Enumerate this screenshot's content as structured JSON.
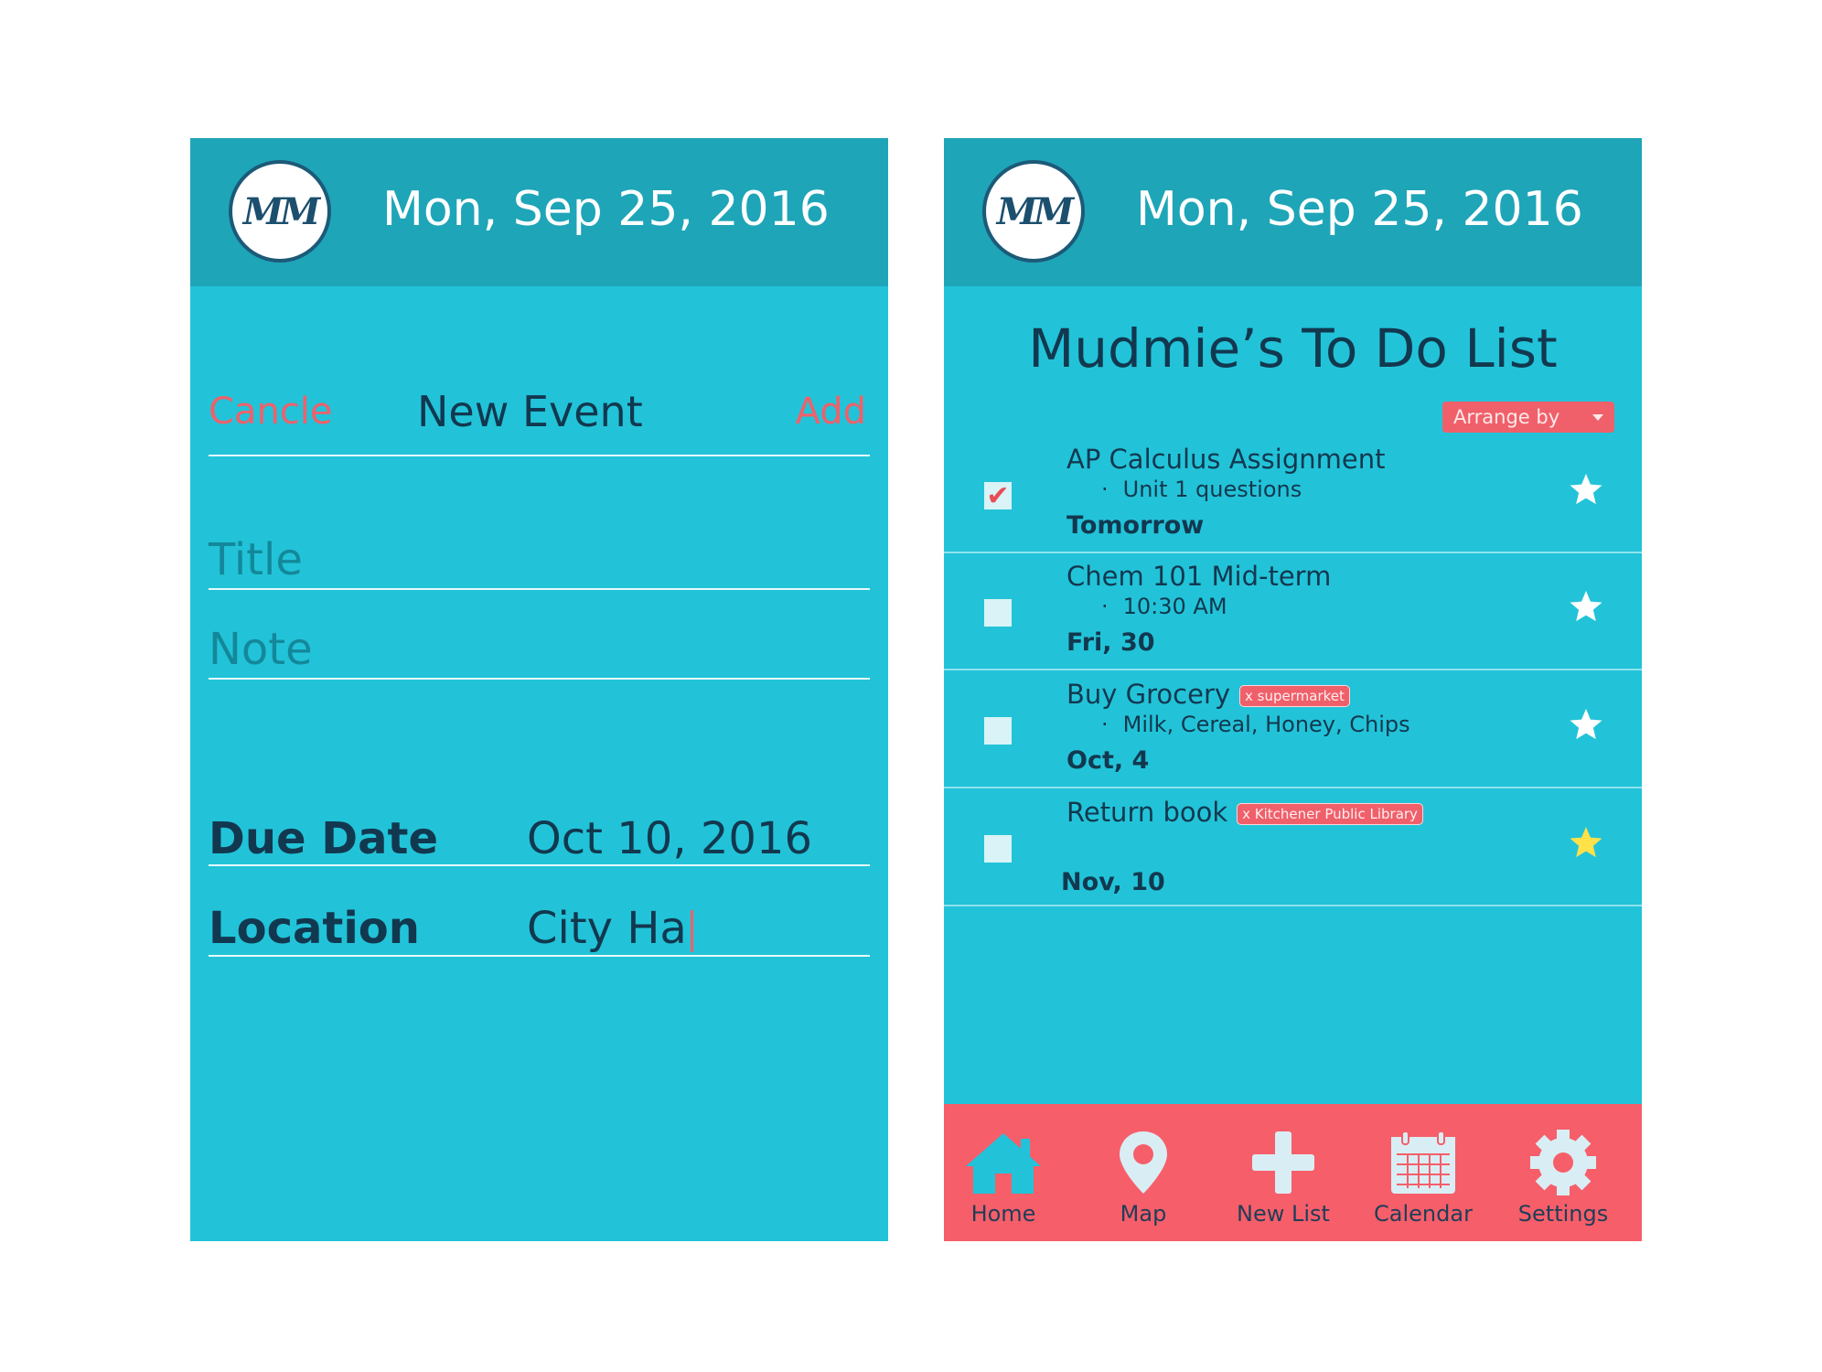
{
  "left_screen": {
    "header": {
      "logo_text": "MM",
      "date": "Mon, Sep 25, 2016"
    },
    "toolbar": {
      "cancel_label": "Cancle",
      "title": "New Event",
      "add_label": "Add"
    },
    "form": {
      "title_placeholder": "Title",
      "note_placeholder": "Note",
      "due_date_label": "Due Date",
      "due_date_value": "Oct 10, 2016",
      "location_label": "Location",
      "location_value": "City Ha"
    }
  },
  "right_screen": {
    "header": {
      "logo_text": "MM",
      "date": "Mon, Sep 25, 2016"
    },
    "list_title": "Mudmie’s To Do List",
    "arrange_label": "Arrange by",
    "items": [
      {
        "title": "AP Calculus Assignment",
        "tag": "",
        "detail": "Unit 1 questions",
        "due": "Tomorrow",
        "checked": true,
        "starred": false
      },
      {
        "title": "Chem 101 Mid-term",
        "tag": "",
        "detail": "10:30 AM",
        "due": "Fri, 30",
        "checked": false,
        "starred": false
      },
      {
        "title": "Buy Grocery",
        "tag": "x supermarket",
        "detail": "Milk, Cereal, Honey, Chips",
        "due": "Oct, 4",
        "checked": false,
        "starred": false
      },
      {
        "title": "Return book",
        "tag": "x Kitchener Public Library",
        "detail": "",
        "due": "Nov, 10",
        "checked": false,
        "starred": true
      }
    ],
    "bullet": "·",
    "check_glyph": "✔",
    "nav": [
      {
        "label": "Home",
        "icon": "home-icon"
      },
      {
        "label": "Map",
        "icon": "map-pin-icon"
      },
      {
        "label": "New List",
        "icon": "plus-icon"
      },
      {
        "label": "Calendar",
        "icon": "calendar-icon"
      },
      {
        "label": "Settings",
        "icon": "gear-icon"
      }
    ],
    "colors": {
      "accent": "#f65e6a",
      "header": "#1ea5b8",
      "body": "#22c3d8",
      "star_active": "#ffe14a"
    }
  }
}
